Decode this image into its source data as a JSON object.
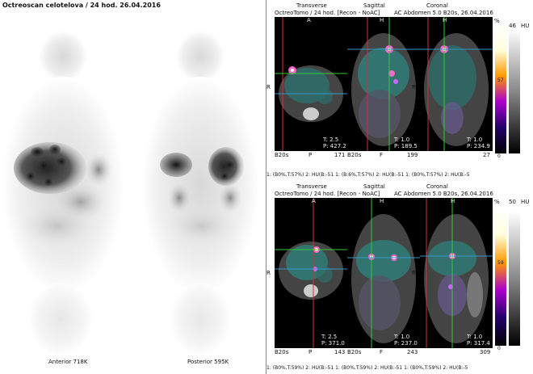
{
  "left": {
    "title": "Octreoscan celotelova / 24 hod. 26.04.2016",
    "anterior_label": "Anterior 718K",
    "posterior_label": "Posterior 595K"
  },
  "top_row": {
    "view_labels": [
      "Transverse",
      "Sagittal",
      "Coronal"
    ],
    "header_left": "OctreoTomo / 24 hod. [Recon - NoAC]",
    "header_right": "AC Abdomen 5.0 B20s, 26.04.2016",
    "orient_top": [
      "A",
      "H",
      "H"
    ],
    "orient_side": [
      "R",
      "L",
      "A",
      "P",
      "R",
      "L"
    ],
    "panel_info": [
      {
        "t": "T: 2.5",
        "p": "P: 427.2",
        "kernel": "B20s",
        "pnum": "P",
        "num": "171"
      },
      {
        "t": "T: 1.0",
        "p": "P: 189.5",
        "kernel": "B20s",
        "pnum": "F",
        "num": "199"
      },
      {
        "t": "T: 1.0",
        "p": "P: 234.9",
        "kernel": "",
        "pnum": "",
        "num": "27"
      }
    ],
    "scale_label_pct": "%",
    "scale_label_hu": "HU",
    "scale_top_value": "46",
    "scale_mid_value": "57",
    "scale_bottom_value": "0",
    "footer": "1: (B0%,T:57%) 2: HU(B:-51 1: (B:6%,T:57%) 2: HU(B:-51 1: (B0%,T:57%) 2: HU(B:-5"
  },
  "bottom_row": {
    "view_labels": [
      "Transverse",
      "Sagittal",
      "Coronal"
    ],
    "header_left": "OctreoTomo / 24 hod. [Recon - NoAC]",
    "header_right": "AC Abdomen 5.0 B20s, 26.04.2016",
    "orient_top": [
      "A",
      "H",
      "H"
    ],
    "orient_side": [
      "R",
      "L",
      "A",
      "P",
      "R",
      "L"
    ],
    "panel_info": [
      {
        "t": "T: 2.5",
        "p": "P: 371.0",
        "kernel": "B20s",
        "pnum": "P",
        "num": "143"
      },
      {
        "t": "T: 1.0",
        "p": "P: 237.0",
        "kernel": "B20s",
        "pnum": "F",
        "num": "243"
      },
      {
        "t": "T: 1.0",
        "p": "P: 317.4",
        "kernel": "",
        "pnum": "",
        "num": "309"
      }
    ],
    "scale_label_pct": "%",
    "scale_label_hu": "HU",
    "scale_top_value": "50",
    "scale_mid_value": "59",
    "scale_bottom_value": "0",
    "footer": "1: (B0%,T:59%) 2: HU(B:-51 1: (B0%,T:59%) 2: HU(B:-51 1: (B0%,T:59%) 2: HU(B:-5"
  }
}
